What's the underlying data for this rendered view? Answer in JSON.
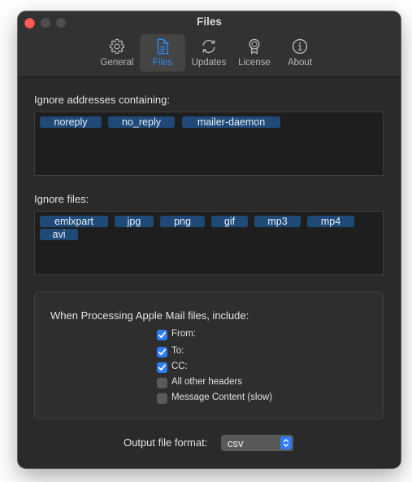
{
  "window": {
    "title": "Files"
  },
  "toolbar": {
    "items": [
      {
        "label": "General",
        "icon": "gear-icon",
        "selected": false
      },
      {
        "label": "Files",
        "icon": "document-icon",
        "selected": true
      },
      {
        "label": "Updates",
        "icon": "refresh-icon",
        "selected": false
      },
      {
        "label": "License",
        "icon": "ribbon-icon",
        "selected": false
      },
      {
        "label": "About",
        "icon": "info-icon",
        "selected": false
      }
    ]
  },
  "ignore_addresses": {
    "label": "Ignore addresses containing:",
    "tokens": [
      "noreply",
      "no_reply",
      "mailer-daemon"
    ]
  },
  "ignore_files": {
    "label": "Ignore files:",
    "tokens": [
      "emlxpart",
      "jpg",
      "png",
      "gif",
      "mp3",
      "mp4",
      "avi"
    ]
  },
  "apple_mail": {
    "title": "When Processing Apple Mail files, include:",
    "options": [
      {
        "label": "From:",
        "checked": true
      },
      {
        "label": "To:",
        "checked": true
      },
      {
        "label": "CC:",
        "checked": true
      },
      {
        "label": "All other headers",
        "checked": false
      },
      {
        "label": "Message Content (slow)",
        "checked": false
      }
    ]
  },
  "output": {
    "label": "Output file format:",
    "value": "csv"
  },
  "colors": {
    "accent": "#2f7cf6",
    "token_bg": "#1f4a78",
    "window_bg": "#2a2a2a",
    "close_button": "#fe5f57"
  }
}
